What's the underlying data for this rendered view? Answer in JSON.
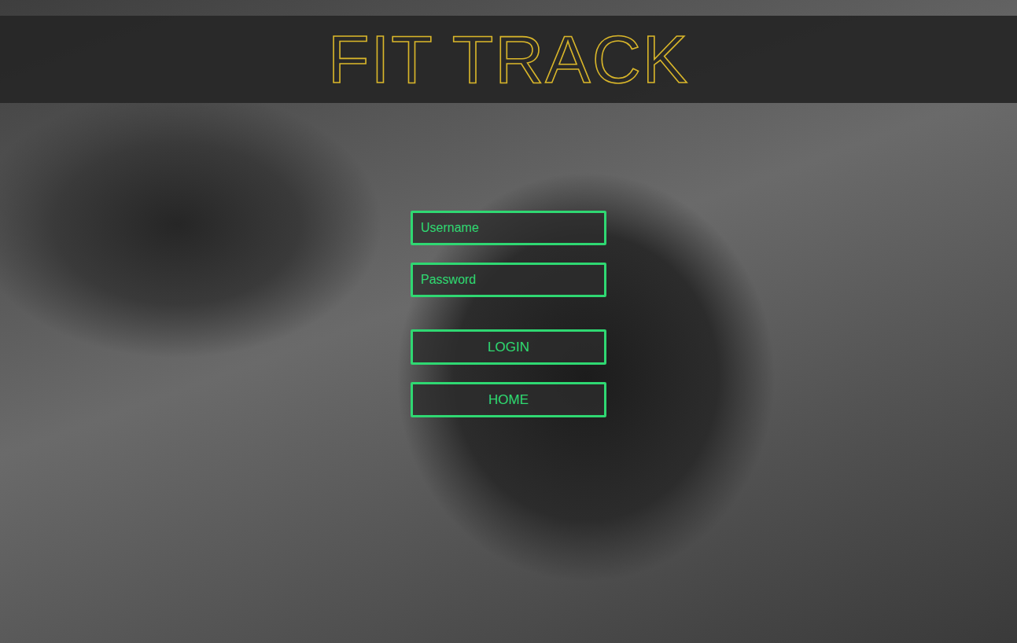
{
  "app": {
    "title": "FIT TRACK"
  },
  "form": {
    "username": {
      "placeholder": "Username"
    },
    "password": {
      "placeholder": "Password"
    }
  },
  "buttons": [
    "LOGIN",
    "HOME"
  ]
}
